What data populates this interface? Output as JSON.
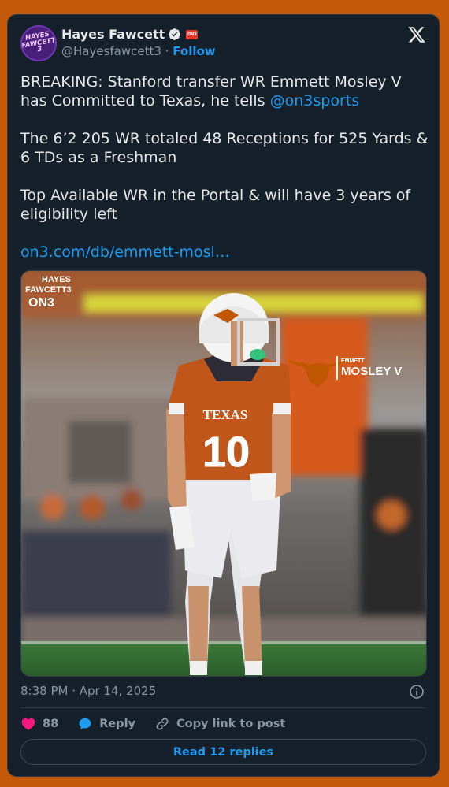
{
  "author": {
    "name": "Hayes Fawcett",
    "handle": "@Hayesfawcett3",
    "separator": "·",
    "follow_label": "Follow",
    "avatar_text": "HAYES\nFAWCETT\n3",
    "badge_text": "ON3"
  },
  "tweet": {
    "p1_text": "BREAKING: Stanford transfer WR Emmett Mosley V has Committed to Texas, he tells ",
    "p1_mention": "@on3sports",
    "p2_text": "The 6’2 205 WR totaled 48 Receptions for 525 Yards & 6 TDs as a Freshman",
    "p3_text": "Top Available WR in the Portal & will have 3 years of eligibility left",
    "link": "on3.com/db/emmett-mosl…"
  },
  "media": {
    "watermark_line1": "HAYES",
    "watermark_line2": "FAWCETT3",
    "watermark_line3": "ON3",
    "player_first": "EMMETT",
    "player_last": "MOSLEY V",
    "jersey_team": "TEXAS",
    "jersey_number": "10"
  },
  "meta": {
    "timestamp": "8:38 PM · Apr 14, 2025"
  },
  "actions": {
    "like_count": "88",
    "reply_label": "Reply",
    "copy_label": "Copy link to post",
    "read_replies_label": "Read 12 replies"
  },
  "colors": {
    "background": "#c4590a",
    "card": "#15202b",
    "accent": "#1d9bf0",
    "like": "#f91880",
    "texas_orange": "#bf5700"
  },
  "icons": [
    "verified-icon",
    "x-logo-icon",
    "info-icon",
    "heart-icon",
    "reply-icon",
    "link-icon"
  ]
}
